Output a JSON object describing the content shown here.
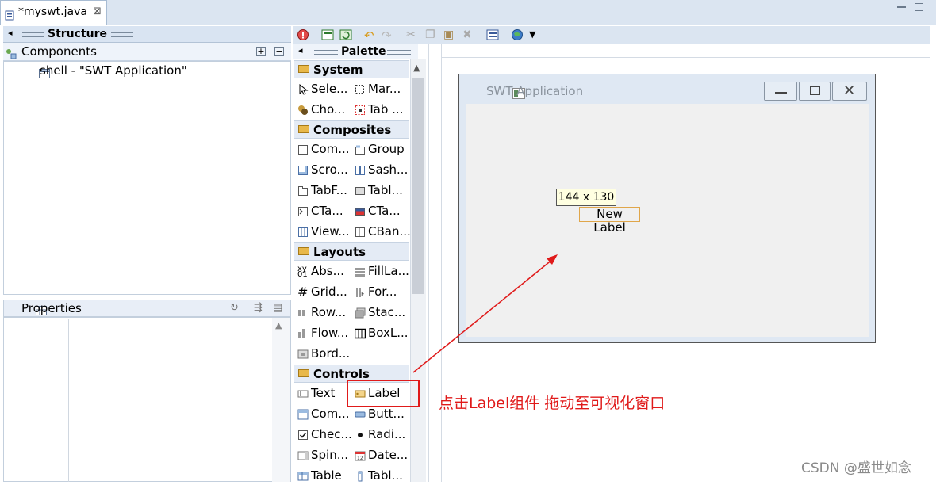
{
  "editor": {
    "tab_title": "*myswt.java",
    "close_glyph": "⊠"
  },
  "structure": {
    "title": "Structure",
    "components_header": "Components",
    "tree_items": [
      "shell - \"SWT Application\""
    ]
  },
  "properties": {
    "title": "Properties"
  },
  "palette": {
    "title": "Palette",
    "categories": {
      "system": {
        "label": "System",
        "items": [
          "Sele...",
          "Mar...",
          "Cho...",
          "Tab ..."
        ]
      },
      "composites": {
        "label": "Composites",
        "items": [
          "Com...",
          "Group",
          "Scro...",
          "Sash...",
          "TabF...",
          "Tabl...",
          "CTa...",
          "CTa...",
          "View...",
          "CBan..."
        ]
      },
      "layouts": {
        "label": "Layouts",
        "items": [
          "Abs...",
          "FillLa...",
          "Grid...",
          "For...",
          "Row...",
          "Stac...",
          "Flow...",
          "BoxL...",
          "Bord..."
        ]
      },
      "controls": {
        "label": "Controls",
        "items": [
          "Text",
          "Label",
          "Com...",
          "Butt...",
          "Chec...",
          "Radi...",
          "Spin...",
          "Date...",
          "Table",
          "Tabl..."
        ]
      }
    }
  },
  "canvas": {
    "window_title": "SWT Application",
    "size_tooltip": "144 x 130",
    "new_label": "New Label"
  },
  "annotation": {
    "text": "点击Label组件 拖动至可视化窗口",
    "color": "#e01a1a"
  },
  "watermark": "CSDN @盛世如念",
  "colors": {
    "panel_header": "#d9e4f2",
    "accent_red": "#e01a1a",
    "tab_strip": "#dbe5f1"
  }
}
